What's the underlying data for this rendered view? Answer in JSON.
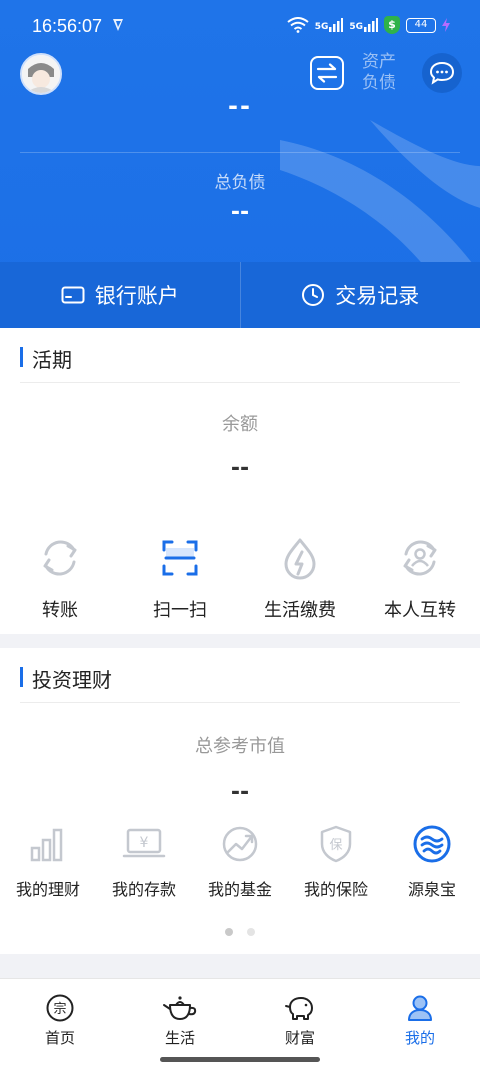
{
  "status": {
    "time": "16:56:07",
    "battery": "44",
    "signal_label": "5G",
    "shield_label": "$"
  },
  "header": {
    "toggle_label": "资产负债",
    "top_value": "--",
    "liability_label": "总负债",
    "liability_value": "--",
    "bank_account": "银行账户",
    "transactions": "交易记录"
  },
  "current": {
    "title": "活期",
    "balance_label": "余额",
    "balance_value": "--",
    "actions": [
      {
        "label": "转账",
        "icon": "transfer-icon"
      },
      {
        "label": "扫一扫",
        "icon": "scan-icon"
      },
      {
        "label": "生活缴费",
        "icon": "utility-icon"
      },
      {
        "label": "本人互转",
        "icon": "self-transfer-icon"
      }
    ]
  },
  "invest": {
    "title": "投资理财",
    "total_label": "总参考市值",
    "total_value": "--",
    "items": [
      {
        "label": "我的理财",
        "icon": "bar-chart-icon"
      },
      {
        "label": "我的存款",
        "icon": "deposit-icon",
        "glyph": "¥"
      },
      {
        "label": "我的基金",
        "icon": "fund-trend-icon"
      },
      {
        "label": "我的保险",
        "icon": "insurance-icon",
        "glyph": "保"
      },
      {
        "label": "源泉宝",
        "icon": "yuanquanbao-icon"
      }
    ]
  },
  "tabs": [
    {
      "label": "首页",
      "icon": "home-icon",
      "glyph": "宗"
    },
    {
      "label": "生活",
      "icon": "teapot-icon"
    },
    {
      "label": "财富",
      "icon": "piggy-bank-icon"
    },
    {
      "label": "我的",
      "icon": "user-icon",
      "active": true
    }
  ],
  "colors": {
    "primary": "#1a6ee8",
    "header": "#1f74e9",
    "muted_icon": "#c4c8cf"
  }
}
